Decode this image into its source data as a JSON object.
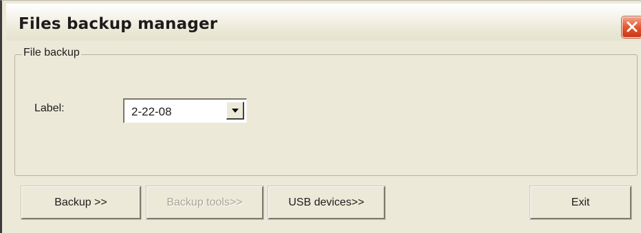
{
  "window": {
    "title": "Files backup manager",
    "close_icon": "close-icon"
  },
  "group": {
    "legend": "File backup",
    "label_text": "Label:",
    "combo_value": "2-22-08",
    "combo_arrow_icon": "chevron-down-icon"
  },
  "buttons": {
    "backup": "Backup >>",
    "backup_tools": "Backup tools>>",
    "usb_devices": "USB devices>>",
    "exit": "Exit"
  },
  "colors": {
    "window_bg": "#ece9d8",
    "close_red": "#e4572e",
    "disabled_text": "#a7a498"
  }
}
